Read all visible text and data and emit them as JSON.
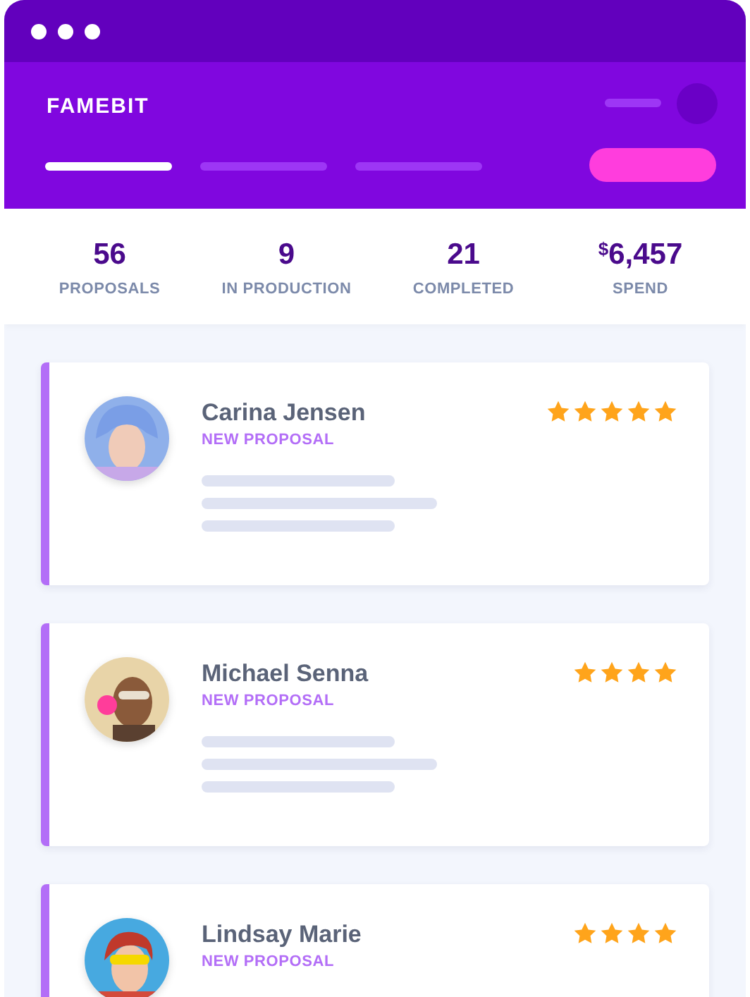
{
  "header": {
    "logo": "FAMEBIT",
    "tabs": [
      {
        "selected": true
      },
      {
        "selected": false
      },
      {
        "selected": false
      }
    ]
  },
  "stats": [
    {
      "value": "56",
      "label": "PROPOSALS"
    },
    {
      "value": "9",
      "label": "IN PRODUCTION"
    },
    {
      "value": "21",
      "label": "COMPLETED"
    },
    {
      "value": "$^{$}$6,457",
      "label": "SPEND"
    }
  ],
  "proposals": [
    {
      "name": "Carina Jensen",
      "status": "NEW PROPOSAL",
      "stars": 5
    },
    {
      "name": "Michael Senna",
      "status": "NEW PROPOSAL",
      "stars": 4
    },
    {
      "name": "Lindsay Marie",
      "status": "NEW PROPOSAL",
      "stars": 4
    }
  ]
}
